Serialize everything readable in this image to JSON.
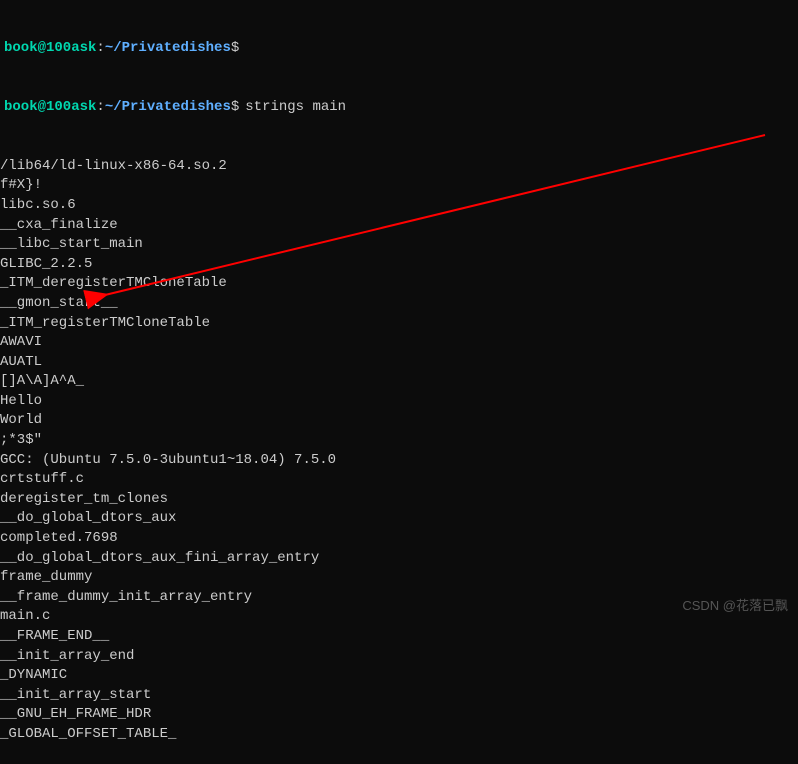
{
  "prompts": [
    {
      "arrow": "",
      "user_host": "book@100ask",
      "colon": ":",
      "path": "~/Privatedishes",
      "dollar": "$",
      "command": ""
    },
    {
      "arrow": "",
      "user_host": "book@100ask",
      "colon": ":",
      "path": "~/Privatedishes",
      "dollar": "$",
      "command": "strings main"
    }
  ],
  "output": [
    "/lib64/ld-linux-x86-64.so.2",
    "f#X}!",
    "libc.so.6",
    "__cxa_finalize",
    "__libc_start_main",
    "GLIBC_2.2.5",
    "_ITM_deregisterTMCloneTable",
    "__gmon_start__",
    "_ITM_registerTMCloneTable",
    "AWAVI",
    "AUATL",
    "[]A\\A]A^A_",
    "Hello",
    "World",
    ";*3$\"",
    "GCC: (Ubuntu 7.5.0-3ubuntu1~18.04) 7.5.0",
    "crtstuff.c",
    "deregister_tm_clones",
    "__do_global_dtors_aux",
    "completed.7698",
    "__do_global_dtors_aux_fini_array_entry",
    "frame_dummy",
    "__frame_dummy_init_array_entry",
    "main.c",
    "__FRAME_END__",
    "__init_array_end",
    "_DYNAMIC",
    "__init_array_start",
    "__GNU_EH_FRAME_HDR",
    "_GLOBAL_OFFSET_TABLE_"
  ],
  "watermark": "CSDN @花落已飘"
}
